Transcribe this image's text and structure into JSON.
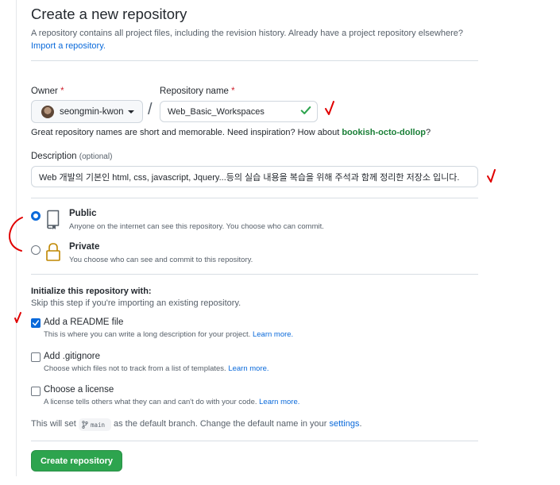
{
  "header": {
    "title": "Create a new repository",
    "subtitle": "A repository contains all project files, including the revision history. Already have a project repository elsewhere?",
    "import_link": "Import a repository."
  },
  "owner": {
    "label": "Owner",
    "required_mark": "*",
    "value": "seongmin-kwon",
    "separator": "/"
  },
  "repository": {
    "label": "Repository name",
    "required_mark": "*",
    "value": "Web_Basic_Workspaces"
  },
  "name_hint": {
    "text": "Great repository names are short and memorable. Need inspiration? How about ",
    "suggestion": "bookish-octo-dollop",
    "suffix": "?"
  },
  "description": {
    "label": "Description",
    "optional": "(optional)",
    "value": "Web 개발의 기본인 html, css, javascript, Jquery...등의 실습 내용을 복습을 위해 주석과 함께 정리한 저장소 입니다."
  },
  "visibility": {
    "selected": "public",
    "public": {
      "title": "Public",
      "note": "Anyone on the internet can see this repository. You choose who can commit."
    },
    "private": {
      "title": "Private",
      "note": "You choose who can see and commit to this repository."
    }
  },
  "initialize": {
    "heading": "Initialize this repository with:",
    "subheading": "Skip this step if you're importing an existing repository.",
    "readme": {
      "label": "Add a README file",
      "checked": true,
      "note": "This is where you can write a long description for your project.",
      "learn_more": "Learn more."
    },
    "gitignore": {
      "label": "Add .gitignore",
      "checked": false,
      "note": "Choose which files not to track from a list of templates.",
      "learn_more": "Learn more."
    },
    "license": {
      "label": "Choose a license",
      "checked": false,
      "note": "A license tells others what they can and can't do with your code.",
      "learn_more": "Learn more."
    }
  },
  "default_branch": {
    "prefix": "This will set",
    "branch": "main",
    "middle": "as the default branch. Change the default name in your",
    "settings_link": "settings",
    "suffix": "."
  },
  "submit": {
    "label": "Create repository"
  },
  "colors": {
    "primary_button": "#2da44e",
    "link": "#0969da",
    "required": "#cf222e",
    "suggestion": "#1a7f37",
    "valid_check": "#2da44e",
    "annotation_marks": "#e00000"
  },
  "icons": {
    "valid": "check-icon",
    "public": "repo-book-icon",
    "private": "lock-icon",
    "branch": "git-branch-icon",
    "owner_dropdown": "caret-down-icon"
  }
}
